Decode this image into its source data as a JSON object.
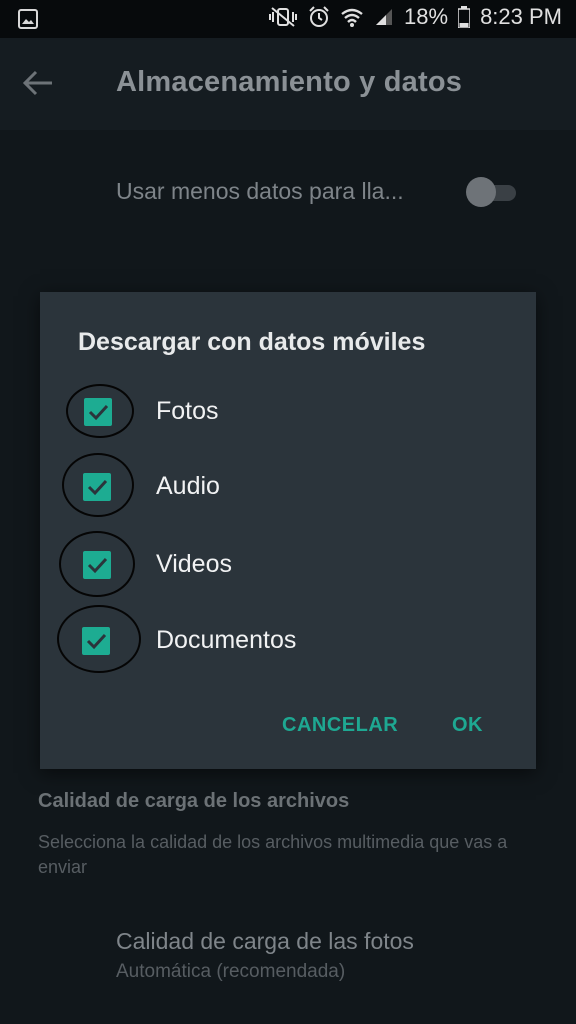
{
  "status_bar": {
    "battery": "18%",
    "time": "8:23 PM"
  },
  "toolbar": {
    "title": "Almacenamiento y datos"
  },
  "settings": {
    "less_data_calls": "Usar menos datos para lla...",
    "less_data_enabled": false,
    "upload_quality_header": "Calidad de carga de los archivos",
    "upload_quality_desc": "Selecciona la calidad de los archivos multimedia que vas a enviar",
    "photo_quality_title": "Calidad de carga de las fotos",
    "photo_quality_value": "Automática (recomendada)"
  },
  "dialog": {
    "title": "Descargar con datos móviles",
    "options": [
      {
        "label": "Fotos",
        "checked": true
      },
      {
        "label": "Audio",
        "checked": true
      },
      {
        "label": "Videos",
        "checked": true
      },
      {
        "label": "Documentos",
        "checked": true
      }
    ],
    "cancel_label": "CANCELAR",
    "ok_label": "OK"
  },
  "colors": {
    "accent": "#1dac92",
    "dialog_bg": "#2b343b",
    "background": "#11171b"
  }
}
